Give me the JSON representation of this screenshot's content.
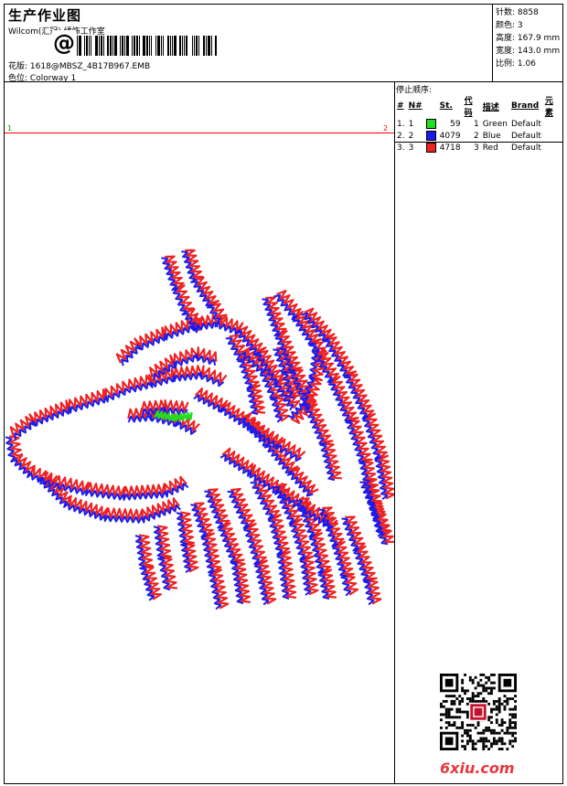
{
  "header": {
    "title": "生产作业图",
    "company": "Wilcom(汇冠) 绣饰工作室",
    "barcode_symbol": "@",
    "design_label": "花版:",
    "design_value": "1618@MBSZ_4B17B967.EMB",
    "colorway_label": "色位:",
    "colorway_value": "Colorway 1"
  },
  "stats": [
    {
      "label": "针数:",
      "value": "8858"
    },
    {
      "label": "颜色:",
      "value": "3"
    },
    {
      "label": "高度:",
      "value": "167.9 mm"
    },
    {
      "label": "宽度:",
      "value": "143.0 mm"
    },
    {
      "label": "比例:",
      "value": "1.06"
    }
  ],
  "color_sequence": {
    "title": "停止顺序:",
    "columns": [
      "#",
      "N#",
      "",
      "St.",
      "代码",
      "描述",
      "Brand",
      "元素"
    ],
    "rows": [
      {
        "order": "1.",
        "n": "1",
        "color": "#22dd22",
        "stitches": "59",
        "code": "1",
        "desc": "Green",
        "brand": "Default"
      },
      {
        "order": "2.",
        "n": "2",
        "color": "#1a1aee",
        "stitches": "4079",
        "code": "2",
        "desc": "Blue",
        "brand": "Default"
      },
      {
        "order": "3.",
        "n": "3",
        "color": "#ee2222",
        "stitches": "4718",
        "code": "3",
        "desc": "Red",
        "brand": "Default"
      }
    ]
  },
  "markers": {
    "left": "1",
    "right": "2"
  },
  "watermark": "6xiu.com",
  "colors": {
    "red": "#ee2222",
    "blue": "#1a1aee",
    "green": "#22dd22",
    "guide_line": "#ff0000"
  }
}
